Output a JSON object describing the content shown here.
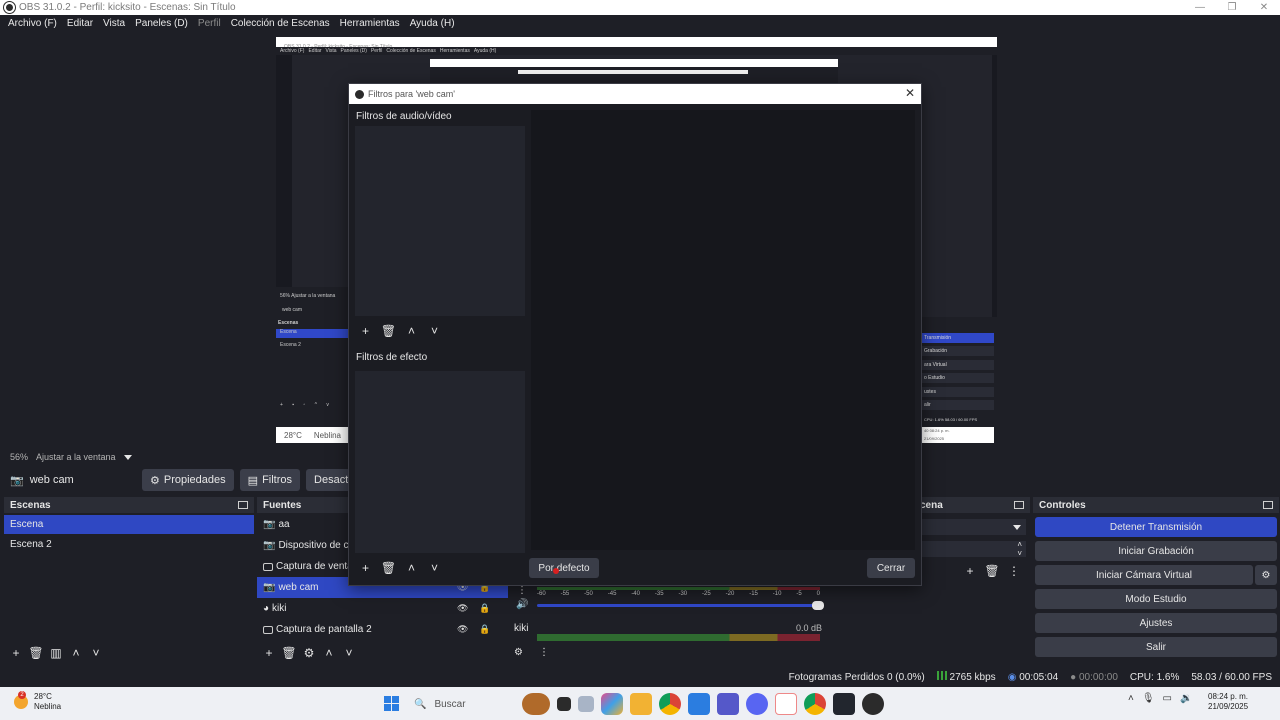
{
  "window": {
    "title": "OBS 31.0.2 - Perfil: kicksito - Escenas: Sin Título",
    "controls": [
      "—",
      "❐",
      "✕"
    ]
  },
  "menu": [
    "Archivo (F)",
    "Editar",
    "Vista",
    "Paneles (D)",
    "Perfil",
    "Colección de Escenas",
    "Herramientas",
    "Ayuda (H)"
  ],
  "preview_zoom": {
    "percent": "56%",
    "mode": "Ajustar a la ventana"
  },
  "source_bar": {
    "source_name": "web cam",
    "properties_label": "Propiedades",
    "filters_label": "Filtros",
    "deactivate_label": "Desactivar"
  },
  "scenes_dock": {
    "title": "Escenas",
    "items": [
      "Escena",
      "Escena 2"
    ],
    "selected_index": 0
  },
  "sources_dock": {
    "title": "Fuentes",
    "items": [
      "aa",
      "Dispositivo de capt",
      "Captura de ventan",
      "web cam",
      "kiki",
      "Captura de pantalla 2"
    ],
    "selected_index": 3
  },
  "mixer": {
    "db_value": "0.0 dB",
    "track_name": "kiki",
    "ticks": [
      "-60",
      "-55",
      "-50",
      "-45",
      "-40",
      "-35",
      "-30",
      "-25",
      "-20",
      "-15",
      "-10",
      "-5",
      "0"
    ]
  },
  "transitions_dock": {
    "title_partial": "cena"
  },
  "controls_dock": {
    "title": "Controles",
    "stop_stream": "Detener Transmisión",
    "start_recording": "Iniciar Grabación",
    "start_virtual_cam": "Iniciar Cámara Virtual",
    "studio_mode": "Modo Estudio",
    "settings": "Ajustes",
    "exit": "Salir"
  },
  "status_bar": {
    "dropped_frames": "Fotogramas Perdidos 0 (0.0%)",
    "bitrate": "2765 kbps",
    "stream_time": "00:05:04",
    "record_time": "00:00:00",
    "cpu": "CPU: 1.6%",
    "fps": "58.03 / 60.00 FPS"
  },
  "taskbar": {
    "weather_temp": "28°C",
    "weather_desc": "Neblina",
    "weather_badge": "2",
    "search_placeholder": "Buscar",
    "time": "08:24 p. m.",
    "date": "21/09/2025"
  },
  "nested_preview": {
    "title": "OBS 31.0.2 - Perfil: kicksito - Escenas: Sin Título",
    "menu": [
      "Archivo (F)",
      "Editar",
      "Vista",
      "Paneles (D)",
      "Perfil",
      "Colección de Escenas",
      "Herramientas",
      "Ayuda (H)"
    ],
    "zoom": "56%   Ajustar a la ventana",
    "source": "web cam",
    "scenes_title": "Escenas",
    "scene1": "Escena",
    "scene2": "Escena 2",
    "weather": "28°C",
    "weather_desc": "Neblina",
    "controls": [
      "Transmisión",
      "Grabación",
      "ara Virtual",
      "o Estudio",
      "ustes",
      "alir"
    ],
    "cpu": "CPU: 1.6%",
    "fps": "58.03 / 60.00 FPS",
    "time": "08:24 p. m.",
    "date": "21/09/2025",
    "tray_num": "40"
  },
  "filters_dialog": {
    "title": "Filtros para 'web cam'",
    "audio_video_title": "Filtros de audio/vídeo",
    "effect_title": "Filtros de efecto",
    "defaults_label": "Por defecto",
    "close_label": "Cerrar"
  },
  "colors": {
    "accent": "#2f48c3",
    "background": "#1e1f26",
    "dock_header": "#2b2d36"
  }
}
